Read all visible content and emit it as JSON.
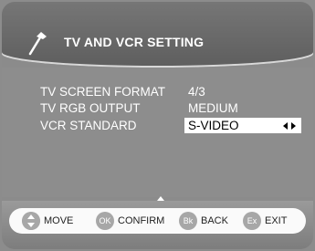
{
  "header": {
    "title": "TV AND VCR SETTING",
    "icon": "wrench-icon"
  },
  "settings": [
    {
      "label": "TV SCREEN FORMAT",
      "value": "4/3"
    },
    {
      "label": "TV RGB OUTPUT",
      "value": "MEDIUM"
    },
    {
      "label": "VCR STANDARD",
      "value": "S-VIDEO",
      "selected": true
    }
  ],
  "footer": {
    "move": {
      "icon_text": "",
      "label": "MOVE"
    },
    "confirm": {
      "icon_text": "OK",
      "label": "CONFIRM"
    },
    "back": {
      "icon_text": "Bk",
      "label": "BACK"
    },
    "exit": {
      "icon_text": "Ex",
      "label": "EXIT"
    }
  },
  "colors": {
    "background": "#8b8b8b",
    "header": "#6a6a6a",
    "text": "#ffffff",
    "highlight": "#ffffff",
    "footer_bar": "#fafafa",
    "footer_icon": "#a7a7a7"
  }
}
